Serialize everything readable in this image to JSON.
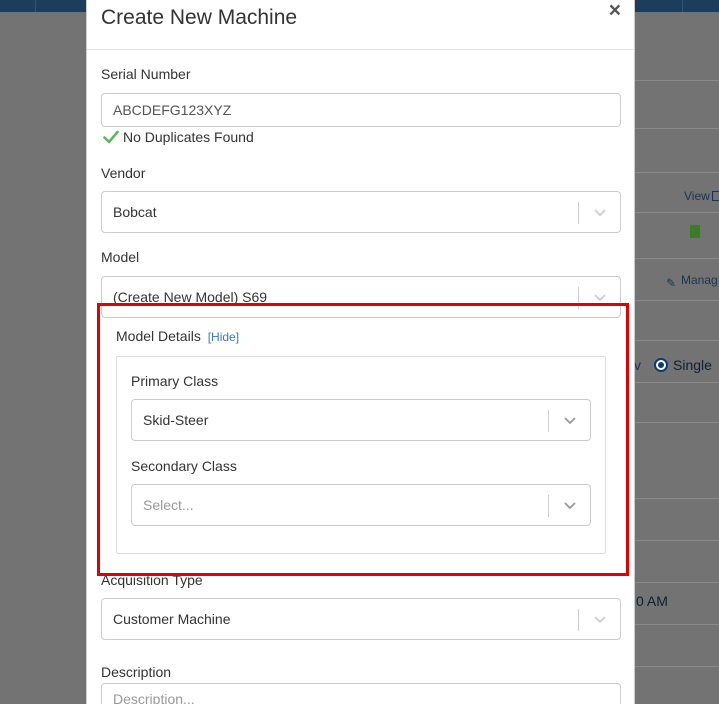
{
  "modal": {
    "title": "Create New Machine",
    "close_symbol": "×",
    "serial": {
      "label": "Serial Number",
      "value": "ABCDEFG123XYZ",
      "status": "No Duplicates Found"
    },
    "vendor": {
      "label": "Vendor",
      "value": "Bobcat"
    },
    "model": {
      "label": "Model",
      "value": "(Create New Model) S69"
    },
    "model_details": {
      "title": "Model Details",
      "hide_link": "[Hide]",
      "primary_class": {
        "label": "Primary Class",
        "value": "Skid-Steer"
      },
      "secondary_class": {
        "label": "Secondary Class",
        "placeholder": "Select..."
      }
    },
    "acquisition": {
      "label": "Acquisition Type",
      "value": "Customer Machine"
    },
    "description": {
      "label": "Description",
      "placeholder": "Description..."
    }
  },
  "background": {
    "view_link": "View",
    "manage_link": "Manag",
    "single_option": "Single",
    "v_fragment": "v",
    "time_fragment": "0 AM"
  },
  "colors": {
    "success_check": "#5cb85c",
    "highlight": "#e00000",
    "link": "#3a78c3"
  }
}
